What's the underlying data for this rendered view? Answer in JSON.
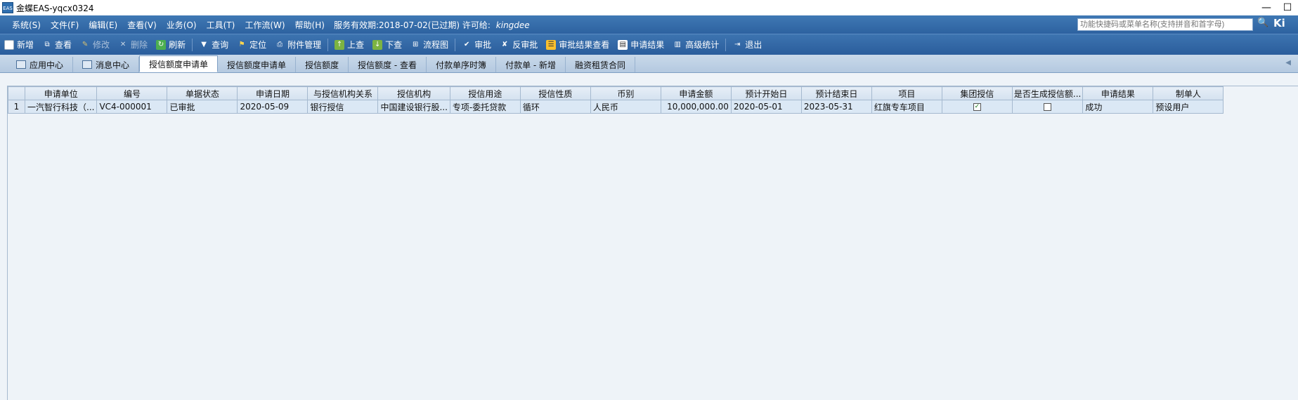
{
  "window": {
    "title": "金蝶EAS-yqcx0324",
    "app_icon_label": "EAS"
  },
  "menubar": {
    "items": [
      "系统(S)",
      "文件(F)",
      "编辑(E)",
      "查看(V)",
      "业务(O)",
      "工具(T)",
      "工作流(W)",
      "帮助(H)"
    ],
    "service_info": "服务有效期:2018-07-02(已过期)",
    "license_label": "许可给:",
    "license_value": "kingdee",
    "search_placeholder": "功能快捷码或菜单名称(支持拼音和首字母)",
    "brand": "Ki"
  },
  "toolbar": {
    "new": "新增",
    "view": "查看",
    "edit": "修改",
    "delete": "删除",
    "refresh": "刷新",
    "query": "查询",
    "locate": "定位",
    "attachment": "附件管理",
    "prev": "上查",
    "next": "下查",
    "flowchart": "流程图",
    "approve": "审批",
    "unapprove": "反审批",
    "approve_result": "审批结果查看",
    "apply_result": "申请结果",
    "advanced_stats": "高级统计",
    "exit": "退出"
  },
  "tabs": [
    "应用中心",
    "消息中心",
    "授信额度申请单",
    "授信额度申请单",
    "授信额度",
    "授信额度 - 查看",
    "付款单序时簿",
    "付款单 - 新增",
    "融资租赁合同"
  ],
  "grid": {
    "columns": [
      "申请单位",
      "编号",
      "单据状态",
      "申请日期",
      "与授信机构关系",
      "授信机构",
      "授信用途",
      "授信性质",
      "币别",
      "申请金额",
      "预计开始日",
      "预计结束日",
      "项目",
      "集团授信",
      "是否生成授信额...",
      "申请结果",
      "制单人"
    ],
    "rows": [
      {
        "rownum": "1",
        "unit": "一汽智行科技（...",
        "code": "VC4-000001",
        "status": "已审批",
        "date": "2020-05-09",
        "relation": "银行授信",
        "institution": "中国建设银行股...",
        "purpose": "专项-委托贷款",
        "nature": "循环",
        "currency": "人民币",
        "amount": "10,000,000.00",
        "start": "2020-05-01",
        "end": "2023-05-31",
        "project": "红旗专车项目",
        "group_credit": true,
        "generated": false,
        "result": "成功",
        "creator": "预设用户"
      }
    ]
  }
}
